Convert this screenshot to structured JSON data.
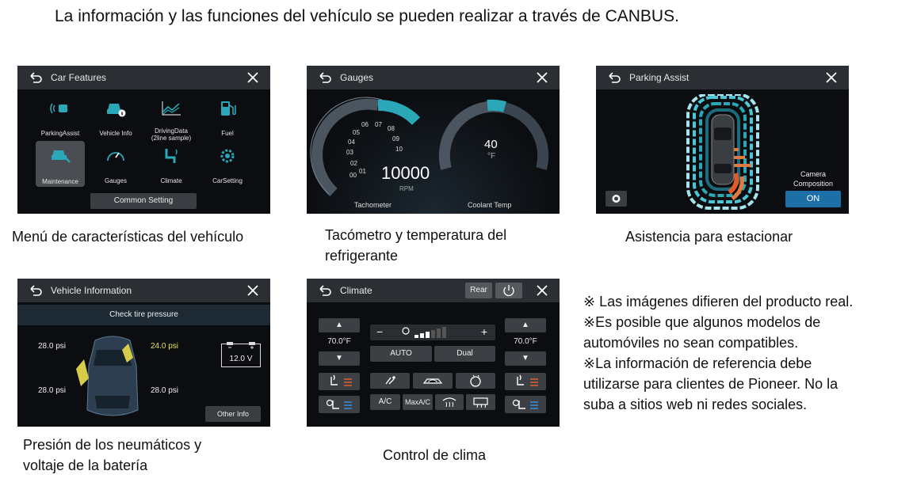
{
  "headline": "La información y las funciones del vehículo se pueden realizar a través de CANBUS.",
  "colors": {
    "accent": "#2aa8b8",
    "panel_bg": "#0b0d10",
    "titlebar": "#2b2e33",
    "highlight": "#e8e15a",
    "on_button": "#1d6fa8"
  },
  "car_features": {
    "title": "Car Features",
    "items": [
      {
        "label": "ParkingAssist",
        "icon": "parking-assist-icon"
      },
      {
        "label": "Vehicle Info",
        "icon": "vehicle-info-icon"
      },
      {
        "label": "DrivingData",
        "sub": "(2line sample)",
        "icon": "driving-data-icon"
      },
      {
        "label": "Fuel",
        "icon": "fuel-icon"
      },
      {
        "label": "Maintenance",
        "icon": "maintenance-icon"
      },
      {
        "label": "Gauges",
        "icon": "gauge-icon"
      },
      {
        "label": "Climate",
        "icon": "climate-icon"
      },
      {
        "label": "CarSetting",
        "icon": "car-setting-icon"
      }
    ],
    "common_setting": "Common Setting",
    "caption": "Menú de características del vehículo"
  },
  "gauges": {
    "title": "Gauges",
    "ticks": [
      "00",
      "01",
      "02",
      "03",
      "04",
      "05",
      "06",
      "07",
      "08",
      "09",
      "10"
    ],
    "rpm_value": "10000",
    "rpm_unit": "RPM",
    "coolant_value": "40",
    "coolant_unit": "°F",
    "tachometer_label": "Tachometer",
    "coolant_label": "Coolant Temp",
    "caption_line1": "Tacómetro y temperatura del",
    "caption_line2": "refrigerante"
  },
  "parking": {
    "title": "Parking Assist",
    "camera_label_line1": "Camera",
    "camera_label_line2": "Composition",
    "on_label": "ON",
    "caption": "Asistencia para estacionar"
  },
  "vehicle_info": {
    "title": "Vehicle Information",
    "banner": "Check tire pressure",
    "fl": "28.0 psi",
    "fr": "24.0 psi",
    "rl": "28.0 psi",
    "rr": "28.0 psi",
    "battery": "12.0 V",
    "other_info": "Other Info",
    "caption_line1": "Presión de los neumáticos y",
    "caption_line2": "voltaje de la batería"
  },
  "climate": {
    "title": "Climate",
    "rear": "Rear",
    "left_temp": "70.0°F",
    "right_temp": "70.0°F",
    "minus": "−",
    "plus": "+",
    "auto": "AUTO",
    "dual": "Dual",
    "ac": "A/C",
    "max_ac": "MaxA/C",
    "up": "▲",
    "down": "▼",
    "caption": "Control de clima"
  },
  "notes": [
    "※ Las imágenes difieren del producto real.",
    "※Es posible que algunos modelos de",
    "automóviles no sean compatibles.",
    "※La información de referencia debe",
    "utilizarse para clientes de Pioneer. No la",
    "suba a sitios web ni redes sociales."
  ]
}
